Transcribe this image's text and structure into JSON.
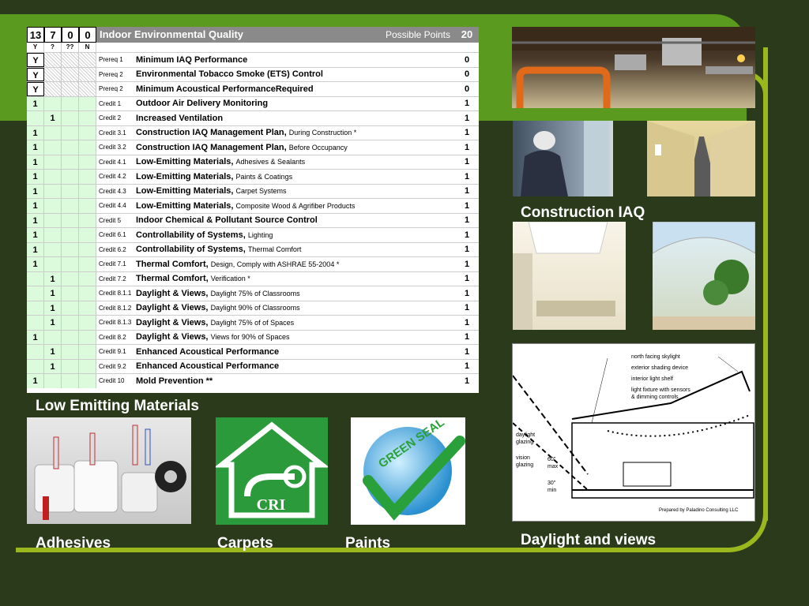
{
  "table": {
    "counts": [
      "13",
      "7",
      "0",
      "0"
    ],
    "title": "Indoor Environmental Quality",
    "possible_label": "Possible Points",
    "possible_total": "20",
    "subheaders": [
      "Y",
      "?",
      "??",
      "N"
    ],
    "rows": [
      {
        "mark": "Y",
        "col": 0,
        "type": "prereq",
        "code": "Prereq 1",
        "title": "Minimum IAQ Performance",
        "sub": "",
        "pts": "0"
      },
      {
        "mark": "Y",
        "col": 0,
        "type": "prereq",
        "code": "Prereq 2",
        "title": "Environmental Tobacco Smoke (ETS) Control",
        "sub": "",
        "pts": "0"
      },
      {
        "mark": "Y",
        "col": 0,
        "type": "prereq",
        "code": "Prereq 2",
        "title": "Minimum Acoustical PerformanceRequired",
        "sub": "",
        "pts": "0"
      },
      {
        "mark": "1",
        "col": 0,
        "type": "credit",
        "code": "Credit 1",
        "title": "Outdoor Air Delivery Monitoring",
        "sub": "",
        "pts": "1"
      },
      {
        "mark": "1",
        "col": 1,
        "type": "credit",
        "code": "Credit 2",
        "title": "Increased Ventilation",
        "sub": "",
        "pts": "1"
      },
      {
        "mark": "1",
        "col": 0,
        "type": "credit",
        "code": "Credit 3.1",
        "title": "Construction IAQ Management Plan,",
        "sub": "During Construction *",
        "pts": "1"
      },
      {
        "mark": "1",
        "col": 0,
        "type": "credit",
        "code": "Credit 3.2",
        "title": "Construction IAQ Management Plan,",
        "sub": "Before Occupancy",
        "pts": "1"
      },
      {
        "mark": "1",
        "col": 0,
        "type": "credit",
        "code": "Credit 4.1",
        "title": "Low-Emitting Materials,",
        "sub": "Adhesives & Sealants",
        "pts": "1"
      },
      {
        "mark": "1",
        "col": 0,
        "type": "credit",
        "code": "Credit 4.2",
        "title": "Low-Emitting Materials,",
        "sub": "Paints & Coatings",
        "pts": "1"
      },
      {
        "mark": "1",
        "col": 0,
        "type": "credit",
        "code": "Credit 4.3",
        "title": "Low-Emitting Materials,",
        "sub": "Carpet Systems",
        "pts": "1"
      },
      {
        "mark": "1",
        "col": 0,
        "type": "credit",
        "code": "Credit 4.4",
        "title": "Low-Emitting Materials,",
        "sub": "Composite Wood & Agrifiber Products",
        "pts": "1"
      },
      {
        "mark": "1",
        "col": 0,
        "type": "credit",
        "code": "Credit 5",
        "title": "Indoor Chemical & Pollutant Source Control",
        "sub": "",
        "pts": "1"
      },
      {
        "mark": "1",
        "col": 0,
        "type": "credit",
        "code": "Credit 6.1",
        "title": "Controllability of Systems,",
        "sub": "Lighting",
        "pts": "1"
      },
      {
        "mark": "1",
        "col": 0,
        "type": "credit",
        "code": "Credit 6.2",
        "title": "Controllability of Systems,",
        "sub": "Thermal Comfort",
        "pts": "1"
      },
      {
        "mark": "1",
        "col": 0,
        "type": "credit",
        "code": "Credit 7.1",
        "title": "Thermal Comfort,",
        "sub": "Design, Comply with ASHRAE 55-2004 *",
        "pts": "1"
      },
      {
        "mark": "1",
        "col": 1,
        "type": "credit",
        "code": "Credit 7.2",
        "title": "Thermal Comfort,",
        "sub": "Verification *",
        "pts": "1"
      },
      {
        "mark": "1",
        "col": 1,
        "type": "credit",
        "code": "Credit 8.1.1",
        "title": "Daylight & Views,",
        "sub": "Daylight 75% of Classrooms",
        "pts": "1"
      },
      {
        "mark": "1",
        "col": 1,
        "type": "credit",
        "code": "Credit 8.1.2",
        "title": "Daylight & Views,",
        "sub": "Daylight 90% of Classrooms",
        "pts": "1"
      },
      {
        "mark": "1",
        "col": 1,
        "type": "credit",
        "code": "Credit 8.1.3",
        "title": "Daylight & Views,",
        "sub": "Daylight 75% of of Spaces",
        "pts": "1"
      },
      {
        "mark": "1",
        "col": 0,
        "type": "credit",
        "code": "Credit 8.2",
        "title": "Daylight & Views,",
        "sub": "Views for 90% of Spaces",
        "pts": "1"
      },
      {
        "mark": "1",
        "col": 1,
        "type": "credit",
        "code": "Credit 9.1",
        "title": "Enhanced Acoustical Performance",
        "sub": "",
        "pts": "1"
      },
      {
        "mark": "1",
        "col": 1,
        "type": "credit",
        "code": "Credit 9.2",
        "title": "Enhanced Acoustical Performance",
        "sub": "",
        "pts": "1"
      },
      {
        "mark": "1",
        "col": 0,
        "type": "credit",
        "code": "Credit 10",
        "title": "Mold Prevention **",
        "sub": "",
        "pts": "1"
      }
    ]
  },
  "labels": {
    "construction_iaq": "Construction IAQ",
    "low_emitting": "Low Emitting Materials",
    "adhesives": "Adhesives",
    "carpets": "Carpets",
    "paints": "Paints",
    "daylight_views": "Daylight and views"
  },
  "logos": {
    "cri": "CRI",
    "green_seal": "GREEN SEAL"
  },
  "diagram": {
    "annotations": [
      "north facing skylight",
      "exterior shading device",
      "interior light shelf",
      "light fixture with sensors",
      "& dimming controls"
    ],
    "left_labels": [
      "daylight",
      "glazing",
      "vision",
      "glazing"
    ],
    "dims": [
      "60\"",
      "max",
      "30\"",
      "min"
    ],
    "credit": "Prepared by Paladino Consulting LLC"
  },
  "colors": {
    "background": "#2a3a1a",
    "band": "#5a9a1e",
    "frame": "#9ab81e",
    "cell_green": "#dcfadc"
  }
}
